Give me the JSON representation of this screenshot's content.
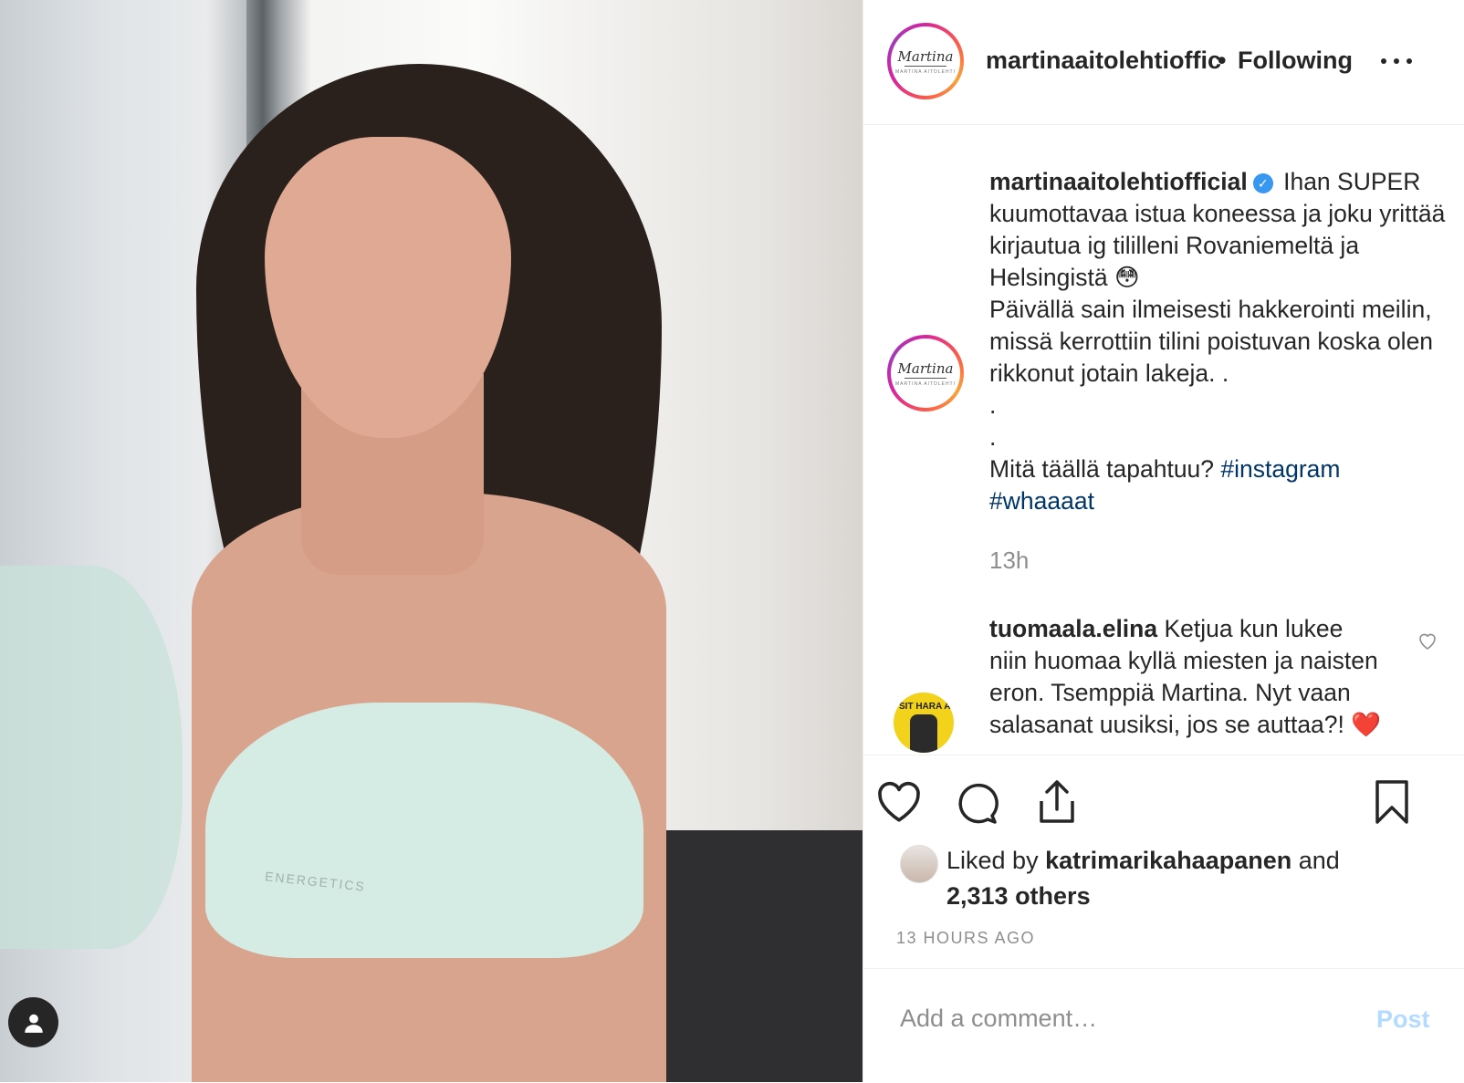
{
  "post": {
    "image_brand_text": "ENERGETICS"
  },
  "header": {
    "username": "martinaaitolehtioffic",
    "separator": "•",
    "follow_status": "Following",
    "avatar_script": "Martina",
    "avatar_small": "MARTINA AITOLEHTI"
  },
  "caption": {
    "username": "martinaaitolehtiofficial",
    "verified_glyph": "✓",
    "lines": [
      "Ihan SUPER kuumottavaa istua koneessa ja joku yrittää kirjautua ig tililleni Rovaniemeltä ja Helsingistä 😳",
      "Päivällä sain ilmeisesti hakkerointi meilin, missä kerrottiin tilini poistuvan koska olen rikkonut jotain lakeja. .",
      ".",
      ".",
      "Mitä täällä tapahtuu?"
    ],
    "hashtags": [
      "#instagram",
      "#whaaaat"
    ],
    "relative_time": "13h"
  },
  "comments": [
    {
      "username": "tuomaala.elina",
      "text": "Ketjua kun lukee niin huomaa kyllä miesten ja naisten eron. Tsemppiä Martina. Nyt vaan salasanat uusiksi, jos se auttaa?! ❤️",
      "avatar_text": "SIT HARA AI"
    }
  ],
  "likes": {
    "prefix": "Liked by",
    "user": "katrimarikahaapanen",
    "and": "and",
    "others": "2,313 others"
  },
  "timestamp": "13 HOURS AGO",
  "comment_box": {
    "placeholder": "Add a comment…",
    "post_label": "Post"
  },
  "colors": {
    "link": "#003569",
    "muted": "#8e8e8e",
    "verified": "#3897f0",
    "post_disabled": "#b3dbff"
  }
}
